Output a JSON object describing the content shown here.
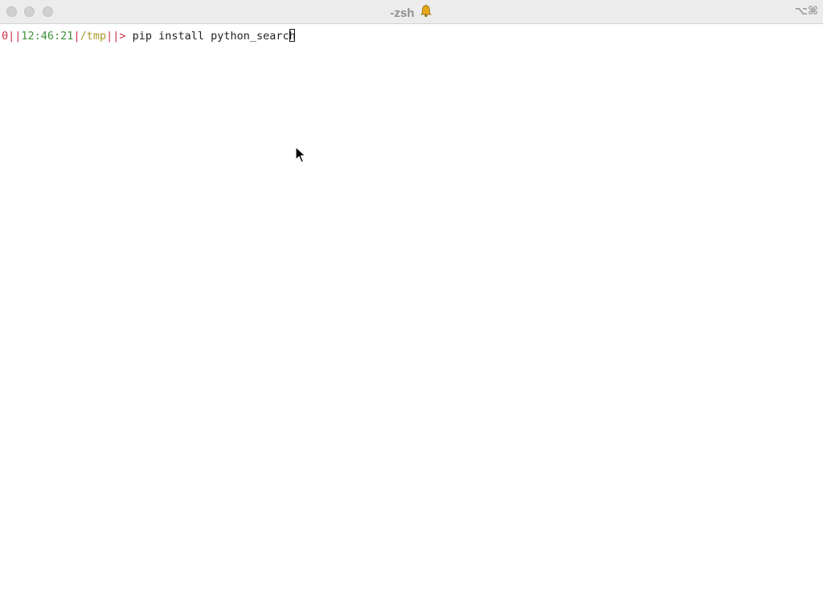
{
  "window": {
    "title": "-zsh",
    "title_icon": "bell-icon",
    "shortcut": "⌥⌘"
  },
  "prompt": {
    "status": "0",
    "sep1": "||",
    "time": "12:46:21",
    "sep2": "|",
    "path": "/tmp",
    "sep3": "||",
    "arrow": ">",
    "command": " pip install python_search"
  },
  "colors": {
    "status": "#d0314a",
    "time": "#3f8f3a",
    "path": "#a89a2a",
    "arrow": "#d0314a",
    "text": "#222222",
    "titlebar": "#ececec"
  }
}
